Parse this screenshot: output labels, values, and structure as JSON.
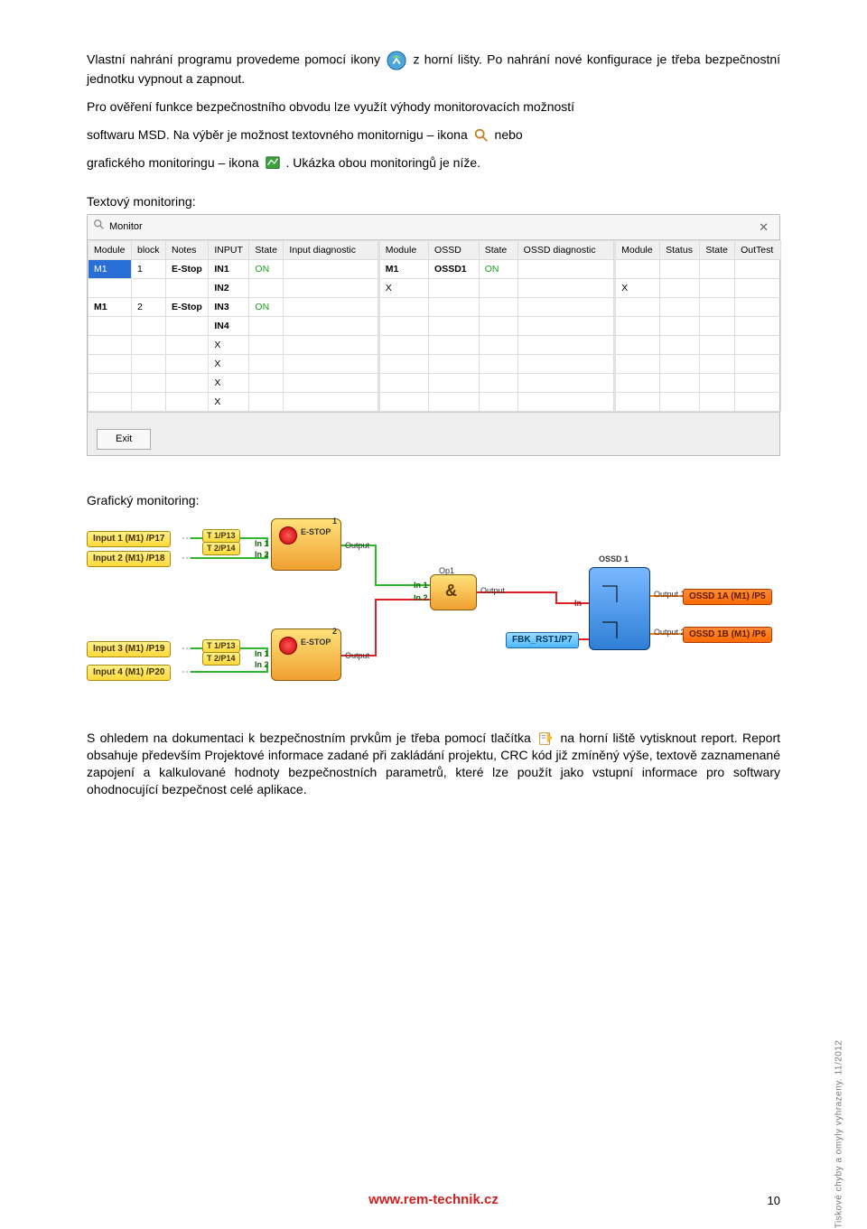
{
  "body": {
    "p1_a": "Vlastní nahrání programu provedeme pomocí ikony ",
    "p1_b": " z horní lišty. Po nahrání nové konfigurace je třeba bezpečnostní jednotku vypnout a zapnout.",
    "p2": "Pro ověření funkce bezpečnostního obvodu lze využít výhody monitorovacích možností",
    "p3_a": "softwaru MSD. Na výběr je možnost textovného monitornigu – ikona ",
    "p3_b": " nebo",
    "p4_a": "grafického monitoringu – ikona ",
    "p4_b": ". Ukázka obou monitoringů je níže.",
    "sec1": "Textový monitoring:",
    "sec2": "Grafický monitoring:",
    "p5_a": "S ohledem na dokumentaci k bezpečnostním prvkům je třeba pomocí tlačítka ",
    "p5_b": " na horní liště vytisknout report. Report obsahuje především Projektové informace zadané při zakládání projektu, CRC kód již zmíněný výše, textově zaznamenané zapojení a kalkulované hodnoty bezpečnostních parametrů, které lze použít jako vstupní informace pro softwary ohodnocující bezpečnost celé aplikace."
  },
  "monitor": {
    "title": "Monitor",
    "close": "✕",
    "exit": "Exit",
    "sect1": {
      "headers": [
        "Module",
        "block",
        "Notes",
        "INPUT",
        "State",
        "Input diagnostic"
      ],
      "rows": [
        [
          "M1",
          "1",
          "E-Stop",
          "IN1",
          "ON",
          ""
        ],
        [
          "",
          "",
          "",
          "IN2",
          "",
          ""
        ],
        [
          "M1",
          "2",
          "E-Stop",
          "IN3",
          "ON",
          ""
        ],
        [
          "",
          "",
          "",
          "IN4",
          "",
          ""
        ],
        [
          "",
          "",
          "",
          "X",
          "",
          ""
        ],
        [
          "",
          "",
          "",
          "X",
          "",
          ""
        ],
        [
          "",
          "",
          "",
          "X",
          "",
          ""
        ],
        [
          "",
          "",
          "",
          "X",
          "",
          ""
        ]
      ]
    },
    "sect2": {
      "headers": [
        "Module",
        "OSSD",
        "State",
        "OSSD diagnostic"
      ],
      "rows": [
        [
          "M1",
          "OSSD1",
          "ON",
          ""
        ],
        [
          "X",
          "",
          "",
          ""
        ],
        [
          "",
          "",
          "",
          ""
        ],
        [
          "",
          "",
          "",
          ""
        ],
        [
          "",
          "",
          "",
          ""
        ],
        [
          "",
          "",
          "",
          ""
        ],
        [
          "",
          "",
          "",
          ""
        ],
        [
          "",
          "",
          "",
          ""
        ]
      ]
    },
    "sect3": {
      "headers": [
        "Module",
        "Status",
        "State",
        "OutTest"
      ],
      "rows": [
        [
          "",
          "",
          "",
          ""
        ],
        [
          "X",
          "",
          "",
          ""
        ],
        [
          "",
          "",
          "",
          ""
        ],
        [
          "",
          "",
          "",
          ""
        ],
        [
          "",
          "",
          "",
          ""
        ],
        [
          "",
          "",
          "",
          ""
        ],
        [
          "",
          "",
          "",
          ""
        ],
        [
          "",
          "",
          "",
          ""
        ]
      ]
    }
  },
  "diagram": {
    "inputs": [
      "Input 1 (M1) /P17",
      "Input 2 (M1) /P18",
      "Input 3 (M1) /P19",
      "Input 4 (M1) /P20"
    ],
    "tlabels": [
      "T 1/P13",
      "T 2/P14",
      "T 1/P13",
      "T 2/P14"
    ],
    "estop": "E-STOP",
    "num1": "1",
    "num2": "2",
    "in1": "In 1",
    "in2": "In 2",
    "output": "Output",
    "op1": "Op1",
    "amp": "&",
    "ossd1": "OSSD 1",
    "fbk": "FBK_RST1/P7",
    "out1": "Output 1",
    "out2": "Output 2",
    "in": "In",
    "ossd1a": "OSSD 1A (M1) /P5",
    "ossd1b": "OSSD 1B (M1) /P6"
  },
  "footer": {
    "url": "www.rem-technik.cz",
    "page": "10",
    "side": "Tiskové chyby a omyly vyhrazeny. 11/2012"
  }
}
